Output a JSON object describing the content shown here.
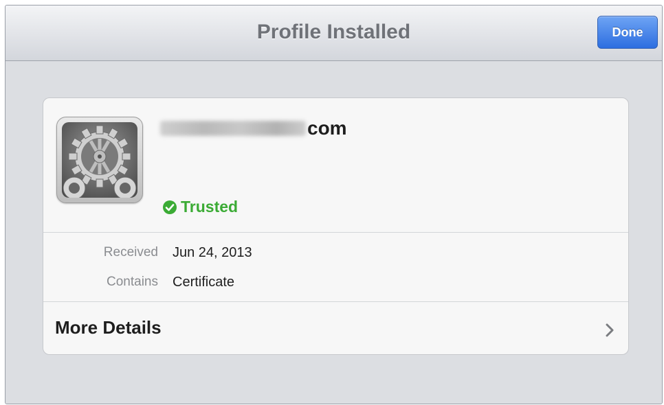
{
  "navbar": {
    "title": "Profile Installed",
    "done_label": "Done"
  },
  "profile": {
    "name_suffix": "com",
    "status": "Trusted",
    "icon": "settings-gear-icon"
  },
  "details": [
    {
      "label": "Received",
      "value": "Jun 24, 2013"
    },
    {
      "label": "Contains",
      "value": "Certificate"
    }
  ],
  "more_details": {
    "label": "More Details",
    "icon": "chevron-right-icon"
  },
  "colors": {
    "done_button": "#2d6ee0",
    "trusted": "#3bab35",
    "title": "#6f7278"
  }
}
